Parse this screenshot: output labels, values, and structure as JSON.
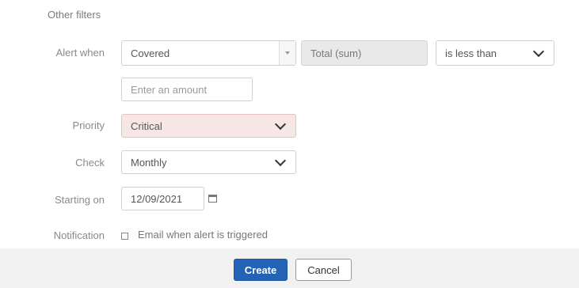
{
  "section": {
    "title": "Other filters"
  },
  "alert_when": {
    "label": "Alert when",
    "field_value": "Covered",
    "aggregate_value": "Total (sum)",
    "operator_value": "is less than",
    "amount_placeholder": "Enter an amount"
  },
  "priority": {
    "label": "Priority",
    "value": "Critical"
  },
  "check": {
    "label": "Check",
    "value": "Monthly"
  },
  "starting_on": {
    "label": "Starting on",
    "value": "12/09/2021"
  },
  "notification": {
    "label": "Notification",
    "checkbox_label": "Email when alert is triggered"
  },
  "buttons": {
    "create": "Create",
    "cancel": "Cancel"
  },
  "colors": {
    "primary": "#2263b6",
    "error_bg": "#f7e6e6",
    "footer_bg": "#f1f1f1"
  }
}
